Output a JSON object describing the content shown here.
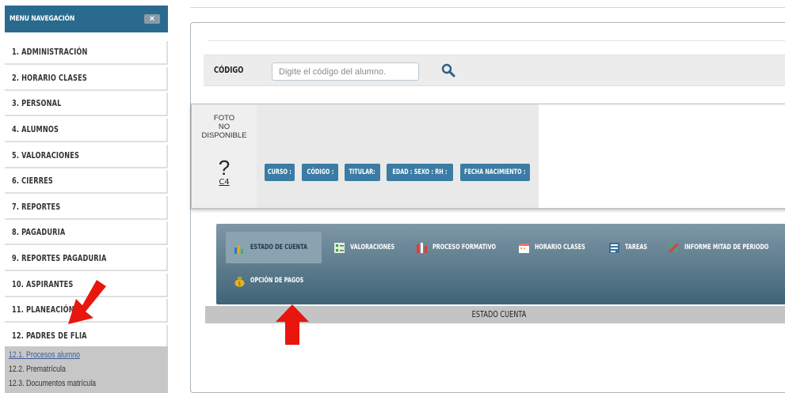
{
  "sidebar": {
    "title": "MENU NAVEGACIÓN",
    "close_icon": "×",
    "items": [
      {
        "label": "1. ADMINISTRACIÓN"
      },
      {
        "label": "2. HORARIO CLASES"
      },
      {
        "label": "3. PERSONAL"
      },
      {
        "label": "4. ALUMNOS"
      },
      {
        "label": "5. VALORACIONES"
      },
      {
        "label": "6. CIERRES"
      },
      {
        "label": "7. REPORTES"
      },
      {
        "label": "8. PAGADURIA"
      },
      {
        "label": "9. REPORTES PAGADURIA"
      },
      {
        "label": "10. ASPIRANTES"
      },
      {
        "label": "11. PLANEACIÓN"
      },
      {
        "label": "12. PADRES DE FLIA"
      }
    ],
    "submenu": [
      {
        "label": "12.1. Procesos alumno"
      },
      {
        "label": "12.2. Prematrícula"
      },
      {
        "label": "12.3. Documentos matrícula"
      }
    ]
  },
  "search": {
    "label": "CÓDIGO",
    "placeholder": "Digite el código del alumno.",
    "icon": "search-icon"
  },
  "student": {
    "photo_text": "FOTO\nNO\nDISPONIBLE",
    "photo_symbol": "?",
    "code": "C4",
    "fields": [
      {
        "label": "CURSO :"
      },
      {
        "label": "CÓDIGO :"
      },
      {
        "label": "TITULAR:"
      },
      {
        "label": "EDAD : SEXO : RH :"
      },
      {
        "label": "FECHA NACIMIENTO :"
      }
    ]
  },
  "tabs": [
    {
      "label": "ESTADO DE CUENTA",
      "icon": "bar-chart-icon",
      "active": true
    },
    {
      "label": "VALORACIONES",
      "icon": "grades-icon"
    },
    {
      "label": "PROCESO FORMATIVO",
      "icon": "process-icon"
    },
    {
      "label": "HORARIO CLASES",
      "icon": "calendar-icon"
    },
    {
      "label": "TAREAS",
      "icon": "tasks-icon"
    },
    {
      "label": "INFORME MITAD DE PERIODO",
      "icon": "percent-icon"
    },
    {
      "label": "OPCIÓN DE PAGOS",
      "icon": "money-bag-icon"
    }
  ],
  "section_title": "ESTADO CUENTA",
  "colors": {
    "header": "#2b6a8f",
    "field_button": "#3b7ca4",
    "annotation_arrow": "#e8160c"
  }
}
